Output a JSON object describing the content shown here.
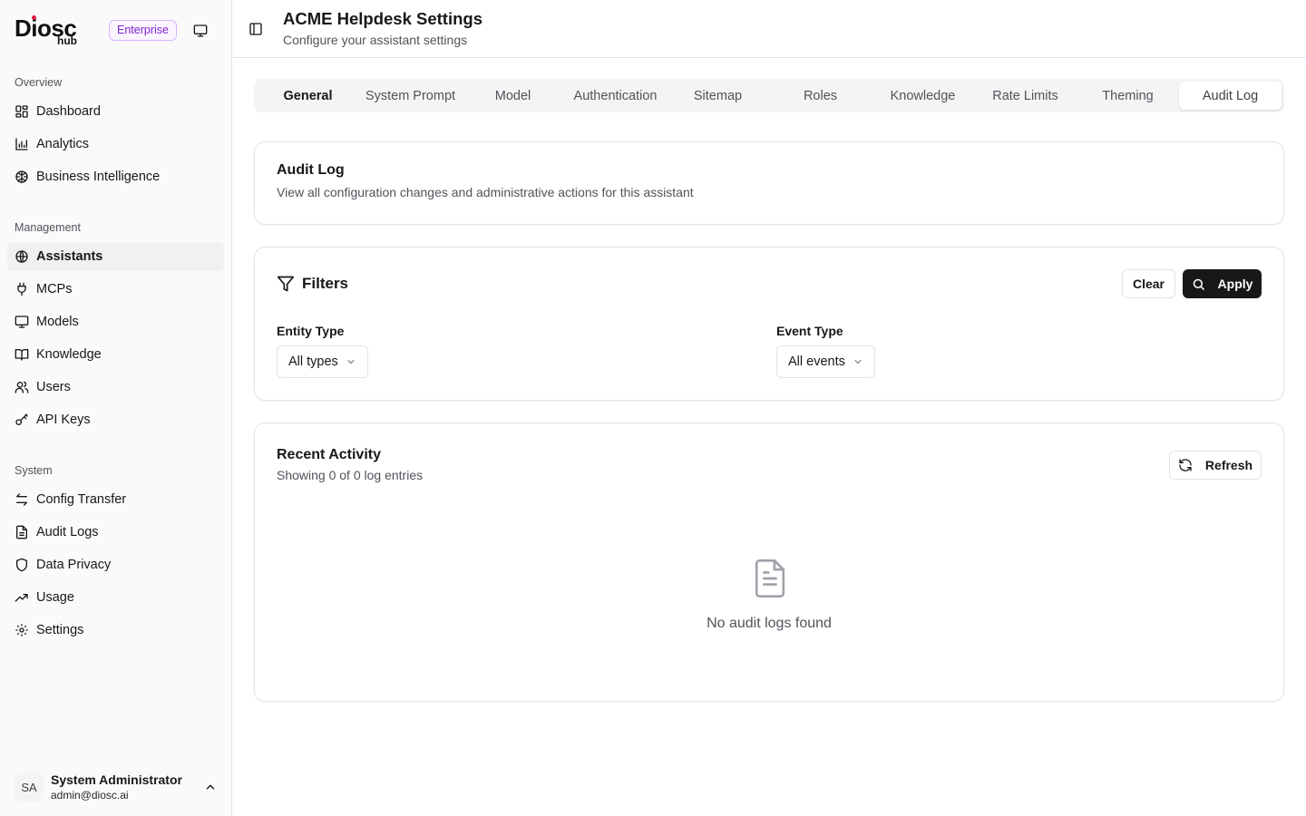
{
  "brand": {
    "name": "Diosc",
    "sub": "hub",
    "badge": "Enterprise"
  },
  "sidebar": {
    "sections": [
      {
        "label": "Overview",
        "items": [
          {
            "label": "Dashboard",
            "icon": "dashboard-icon"
          },
          {
            "label": "Analytics",
            "icon": "bar-chart-icon"
          },
          {
            "label": "Business Intelligence",
            "icon": "brain-icon"
          }
        ]
      },
      {
        "label": "Management",
        "items": [
          {
            "label": "Assistants",
            "icon": "globe-icon",
            "active": true
          },
          {
            "label": "MCPs",
            "icon": "plug-icon"
          },
          {
            "label": "Models",
            "icon": "monitor-icon"
          },
          {
            "label": "Knowledge",
            "icon": "book-icon"
          },
          {
            "label": "Users",
            "icon": "users-icon"
          },
          {
            "label": "API Keys",
            "icon": "key-icon"
          }
        ]
      },
      {
        "label": "System",
        "items": [
          {
            "label": "Config Transfer",
            "icon": "transfer-icon"
          },
          {
            "label": "Audit Logs",
            "icon": "file-text-icon"
          },
          {
            "label": "Data Privacy",
            "icon": "shield-icon"
          },
          {
            "label": "Usage",
            "icon": "trending-up-icon"
          },
          {
            "label": "Settings",
            "icon": "gear-icon"
          }
        ]
      }
    ]
  },
  "user": {
    "initials": "SA",
    "name": "System Administrator",
    "email": "admin@diosc.ai"
  },
  "header": {
    "title": "ACME Helpdesk Settings",
    "subtitle": "Configure your assistant settings"
  },
  "tabs": [
    "General",
    "System Prompt",
    "Model",
    "Authentication",
    "Sitemap",
    "Roles",
    "Knowledge",
    "Rate Limits",
    "Theming",
    "Audit Log"
  ],
  "active_tab": "Audit Log",
  "audit_card": {
    "title": "Audit Log",
    "description": "View all configuration changes and administrative actions for this assistant"
  },
  "filters": {
    "title": "Filters",
    "clear_label": "Clear",
    "apply_label": "Apply",
    "entity_label": "Entity Type",
    "entity_value": "All types",
    "event_label": "Event Type",
    "event_value": "All events"
  },
  "activity": {
    "title": "Recent Activity",
    "summary": "Showing 0 of 0 log entries",
    "refresh_label": "Refresh",
    "empty_text": "No audit logs found"
  }
}
